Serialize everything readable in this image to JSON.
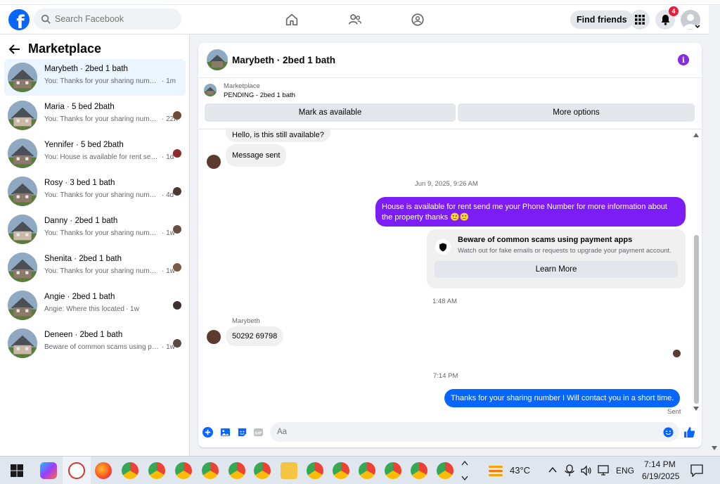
{
  "topbar": {
    "search_placeholder": "Search Facebook",
    "find_friends": "Find friends",
    "notification_count": "4"
  },
  "sidebar": {
    "title": "Marketplace",
    "conversations": [
      {
        "name": "Marybeth · 2bed 1 bath",
        "snippet": "You: Thanks for your sharing number I Will contact you in a short time.",
        "time": "· 1m",
        "active": true
      },
      {
        "name": "Maria · 5 bed 2bath",
        "snippet": "You: Thanks for your sharing number I Will contact you",
        "time": "· 22h"
      },
      {
        "name": "Yennifer · 5 bed 2bath",
        "snippet": "You: House is available for rent send me",
        "time": "· 1d"
      },
      {
        "name": "Rosy · 3 bed 1 bath",
        "snippet": "You: Thanks for your sharing number I Will",
        "time": "· 4d"
      },
      {
        "name": "Danny · 2bed 1 bath",
        "snippet": "You: Thanks for your sharing number I Will",
        "time": "· 1w"
      },
      {
        "name": "Shenita · 2bed 1 bath",
        "snippet": "You: Thanks for your sharing number I Will",
        "time": "· 1w"
      },
      {
        "name": "Angie · 2bed 1 bath",
        "snippet": "Angie: Where this located",
        "time": "· 1w"
      },
      {
        "name": "Deneen · 2bed 1 bath",
        "snippet": "Beware of common scams using payment apps",
        "time": "· 1w"
      }
    ]
  },
  "chat": {
    "title": "Marybeth · 2bed 1 bath",
    "marketplace_label": "Marketplace",
    "listing_status": "PENDING - 2bed 1 bath",
    "mark_available": "Mark as available",
    "more_options": "More options",
    "messages": {
      "m1": "Hello, is this still available?",
      "m2": "Message sent",
      "ts1": "Jun 9, 2025, 9:26 AM",
      "m3_line1": "House is available for rent send me your Phone Number for more information about",
      "m3_line2": "the property thanks 🙂🙂",
      "scam_title": "Beware of common scams using payment apps",
      "scam_sub": "Watch out for fake emails or requests to upgrade your payment account.",
      "learn_more": "Learn More",
      "ts2": "1:48 AM",
      "sender": "Marybeth",
      "m4": "50292 69798",
      "ts3": "7:14 PM",
      "m5": "Thanks for your sharing number I Will contact you in a short time.",
      "sent": "Sent"
    },
    "composer_placeholder": "Aa"
  },
  "taskbar": {
    "weather": "43°C",
    "lang": "ENG",
    "time": "7:14 PM",
    "date": "6/19/2025"
  },
  "colors": {
    "facebook_blue": "#0866ff",
    "purple_bubble": "#7c1df5",
    "notification_red": "#e41e3f"
  }
}
